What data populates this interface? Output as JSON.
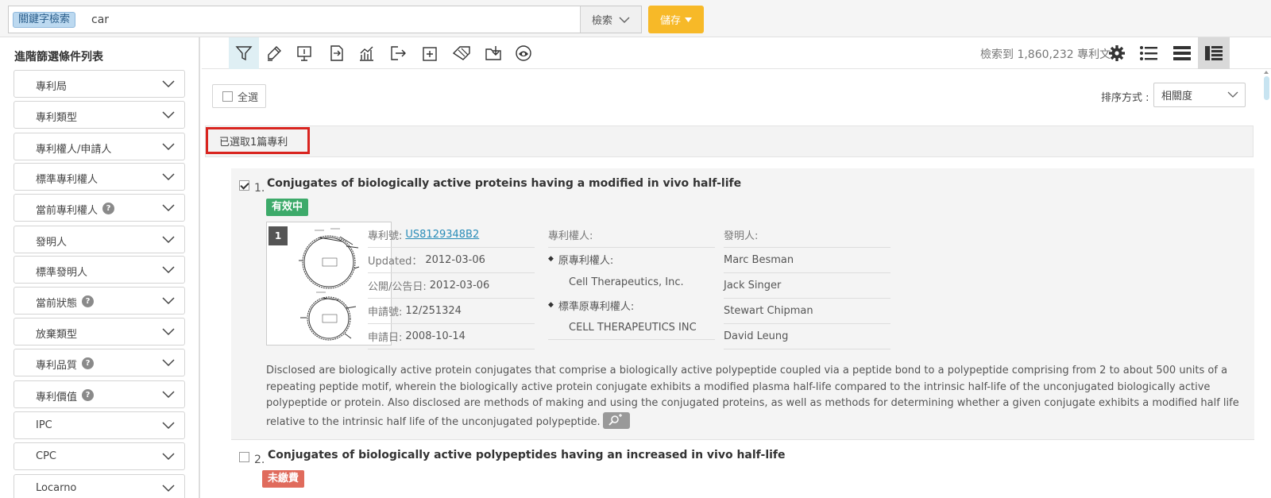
{
  "search": {
    "tag": "關鍵字檢索",
    "value": "car",
    "button": "檢索",
    "save": "儲存"
  },
  "sidebar": {
    "title": "進階篩選條件列表",
    "filters": [
      {
        "label": "專利局",
        "help": false
      },
      {
        "label": "專利類型",
        "help": false
      },
      {
        "label": "專利權人/申請人",
        "help": false
      },
      {
        "label": "標準專利權人",
        "help": false
      },
      {
        "label": "當前專利權人",
        "help": true
      },
      {
        "label": "發明人",
        "help": false
      },
      {
        "label": "標準發明人",
        "help": false
      },
      {
        "label": "當前狀態",
        "help": true
      },
      {
        "label": "放棄類型",
        "help": false
      },
      {
        "label": "專利品質",
        "help": true
      },
      {
        "label": "專利價值",
        "help": true
      },
      {
        "label": "IPC",
        "help": false
      },
      {
        "label": "CPC",
        "help": false
      },
      {
        "label": "Locarno",
        "help": false
      }
    ],
    "help_glyph": "?"
  },
  "toolbar": {
    "tools": [
      "filter-icon",
      "highlighter-icon",
      "presentation-icon",
      "compare-icon",
      "chart-icon",
      "export-icon",
      "add-icon",
      "tag-icon",
      "folder-import-icon",
      "cloud-eye-icon"
    ],
    "result_count": "檢索到 1,860,232 專利文件"
  },
  "list": {
    "select_all": "全選",
    "sort_label": "排序方式 :",
    "sort_value": "相關度",
    "selected_count": "已選取1篇專利"
  },
  "results": [
    {
      "num": "1.",
      "title": "Conjugates of biologically active proteins having a modified in vivo half-life",
      "status": "有效中",
      "thumb_num": "1",
      "patent_no_label": "專利號:",
      "patent_no": "US8129348B2",
      "updated_label": "Updated：",
      "updated": "2012-03-06",
      "pub_label": "公開/公告日:",
      "pub": "2012-03-06",
      "app_no_label": "申請號:",
      "app_no": "12/251324",
      "app_date_label": "申請日:",
      "app_date": "2008-10-14",
      "assignee_label": "專利權人:",
      "orig_assignee_label": "原專利權人:",
      "orig_assignee": "Cell Therapeutics, Inc.",
      "std_assignee_label": "標準原專利權人:",
      "std_assignee": "CELL THERAPEUTICS INC",
      "inventor_label": "發明人:",
      "inventors": [
        "Marc Besman",
        "Jack Singer",
        "Stewart Chipman",
        "David Leung"
      ],
      "abstract": "Disclosed are biologically active protein conjugates that comprise a biologically active polypeptide coupled via a peptide bond to a polypeptide comprising from 2 to about 500 units of a repeating peptide motif, wherein the biologically active protein conjugate exhibits a modified plasma half-life compared to the intrinsic half-life of the unconjugated biologically active polypeptide or protein. Also disclosed are methods of making and using the conjugated proteins, as well as methods for determining whether a given conjugate exhibits a modified half life relative to the intrinsic half life of the unconjugated polypeptide."
    },
    {
      "num": "2.",
      "title": "Conjugates of biologically active polypeptides having an increased in vivo half-life",
      "status": "未繳費"
    }
  ],
  "colors": {
    "accent": "#f7b928",
    "active_status": "#3daa6a",
    "unpaid_status": "#e06b5c",
    "highlight_box": "#d9241f",
    "link": "#2a8cb8"
  }
}
